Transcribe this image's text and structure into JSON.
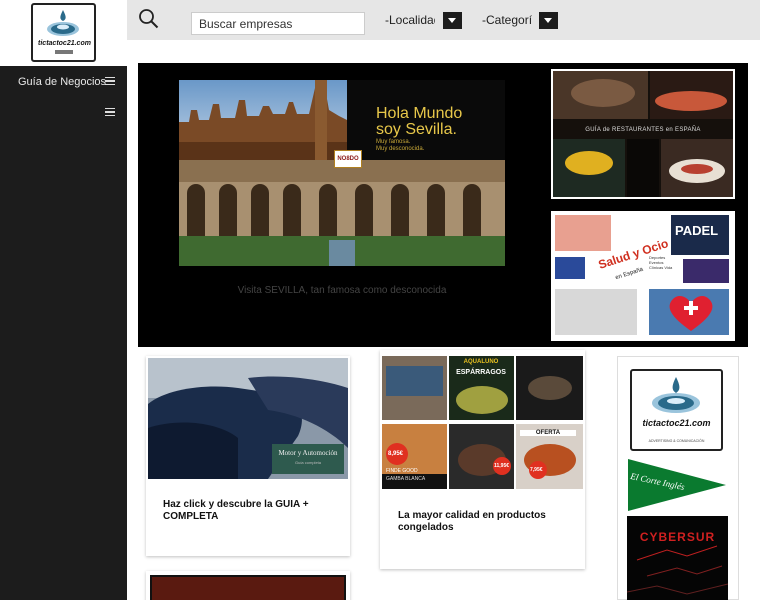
{
  "brand": {
    "logo_text": "tictactoc21.com",
    "logo_tagline": "ADVERTISING & COMUNICACIÓN"
  },
  "sidebar": {
    "items": [
      {
        "label": "Guía de Negocios"
      },
      {
        "label": ""
      }
    ]
  },
  "topbar": {
    "search_placeholder": "Buscar empresas",
    "location_select": "-Localidad",
    "category_select": "-Categoría"
  },
  "hero": {
    "main_headline": "Hola Mundo soy Sevilla.",
    "main_sub1": "Muy famosa.",
    "main_sub2": "Muy desconocida.",
    "badge": "NO8DO",
    "caption": "Visita SEVILLA, tan famosa como desconocida",
    "side1_text": "GUÍA de RESTAURANTES en ESPAÑA",
    "side2_title": "Salud y Ocio",
    "side2_sub": "en España",
    "side2_padel": "PADEL",
    "side2_list": "Deportes Eventos Clínicas Vida"
  },
  "cards": [
    {
      "title": "Haz click y descubre la GUIA + COMPLETA",
      "image_label": "Motor y Automoción",
      "image_sub": "Guía completa"
    },
    {
      "title": "La mayor calidad en productos congelados",
      "image_label": "AQUALUNO",
      "image_sub": "ESPÁRRAGOS",
      "price1": "8,95€",
      "price2": "11,95€",
      "price3": "7,95€",
      "tag": "OFERTA",
      "brand2": "FINDE GOOD",
      "item": "GAMBA BLANCA"
    }
  ],
  "sponsors": {
    "tic_text": "tictactoc21.com",
    "tic_tagline": "ADVERTISING & COMUNICACIÓN",
    "eci_text": "El Corte Inglés",
    "cyber_text": "CYBERSUR"
  },
  "colors": {
    "sidebar_bg": "#1c1c1c",
    "topbar_bg": "#e6e6e6",
    "hero_bg": "#000000",
    "eci_green": "#0a7a2f",
    "logo_blue": "#2a6a8a"
  }
}
